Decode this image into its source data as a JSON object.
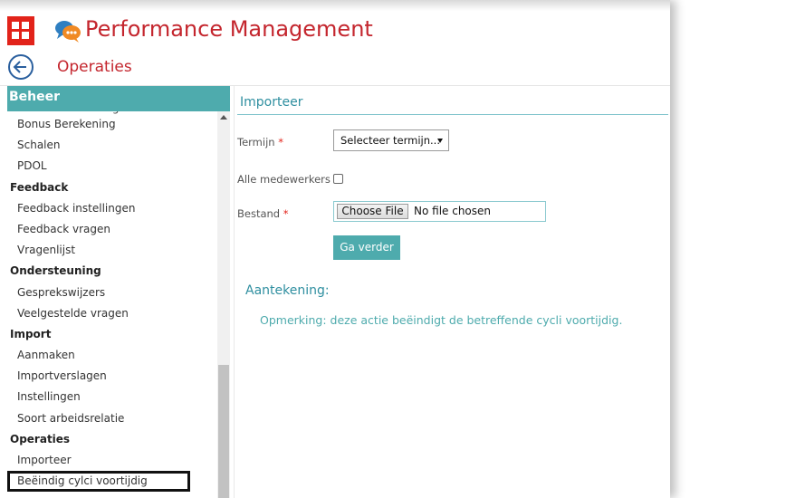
{
  "header": {
    "app_title": "Performance Management",
    "brand_color": "#c4262e",
    "tile_color": "#e2231a"
  },
  "breadcrumb": {
    "title": "Operaties"
  },
  "sidebar": {
    "title": "Beheer",
    "items": [
      {
        "type": "item",
        "label": "Reach Beoordeling",
        "partial": true
      },
      {
        "type": "item",
        "label": "Bonus Berekening"
      },
      {
        "type": "item",
        "label": "Schalen"
      },
      {
        "type": "item",
        "label": "PDOL"
      },
      {
        "type": "group",
        "label": "Feedback"
      },
      {
        "type": "item",
        "label": "Feedback instellingen"
      },
      {
        "type": "item",
        "label": "Feedback vragen"
      },
      {
        "type": "item",
        "label": "Vragenlijst"
      },
      {
        "type": "group",
        "label": "Ondersteuning"
      },
      {
        "type": "item",
        "label": "Gesprekswijzers"
      },
      {
        "type": "item",
        "label": "Veelgestelde vragen"
      },
      {
        "type": "group",
        "label": "Import"
      },
      {
        "type": "item",
        "label": "Aanmaken"
      },
      {
        "type": "item",
        "label": "Importverslagen"
      },
      {
        "type": "item",
        "label": "Instellingen"
      },
      {
        "type": "item",
        "label": "Soort arbeidsrelatie"
      },
      {
        "type": "group",
        "label": "Operaties"
      },
      {
        "type": "item",
        "label": "Importeer"
      },
      {
        "type": "item",
        "label": "Beëindig cylci voortijdig",
        "selected": true
      }
    ],
    "accent_color": "#4eabad"
  },
  "main": {
    "section_title": "Importeer",
    "fields": {
      "termijn_label": "Termijn",
      "termijn_value": "Selecteer termijn...",
      "alle_label": "Alle medewerkers",
      "bestand_label": "Bestand",
      "file_button": "Choose File",
      "file_status": "No file chosen",
      "required_mark": "*"
    },
    "submit_label": "Ga verder",
    "note_title": "Aantekening:",
    "note_text": "Opmerking: deze actie beëindigt de betreffende cycli voortijdig."
  }
}
